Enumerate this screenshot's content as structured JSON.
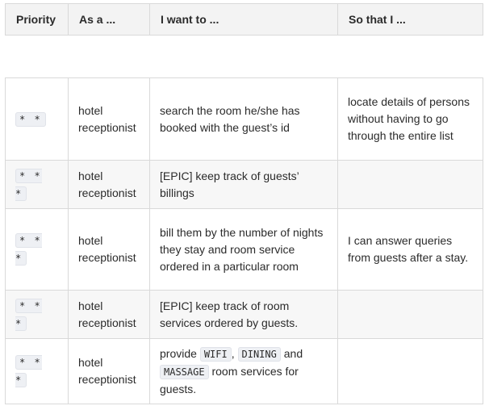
{
  "table": {
    "headers": [
      "Priority",
      "As a ...",
      "I want to ...",
      "So that I ..."
    ],
    "rows": [
      {
        "priority": "* *",
        "role": "hotel receptionist",
        "want": "search the room he/she has booked with the guest’s id",
        "so_that": "locate details of persons without having to go through the entire list"
      },
      {
        "priority": "* * *",
        "role": "hotel receptionist",
        "want": "[EPIC] keep track of guests’ billings",
        "so_that": ""
      },
      {
        "priority": "* * *",
        "role": "hotel receptionist",
        "want": "bill them by the number of nights they stay and room service ordered in a particular room",
        "so_that": "I can answer queries from guests after a stay."
      },
      {
        "priority": "* * *",
        "role": "hotel receptionist",
        "want": "[EPIC] keep track of room services ordered by guests.",
        "so_that": ""
      },
      {
        "priority": "* * *",
        "role": "hotel receptionist",
        "want_parts": {
          "prefix": "provide",
          "code1": "WIFI",
          "sep": ",",
          "code2": "DINING",
          "and": "and",
          "code3": "MASSAGE",
          "suffix": "room services for guests."
        },
        "so_that": ""
      }
    ]
  }
}
